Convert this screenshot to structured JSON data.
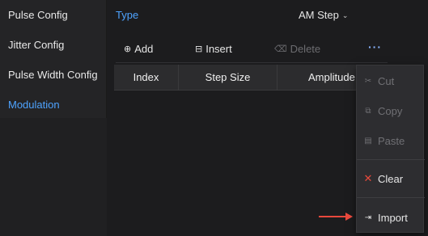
{
  "sidebar": {
    "items": [
      {
        "label": "Pulse Config"
      },
      {
        "label": "Jitter Config"
      },
      {
        "label": "Pulse Width Config"
      },
      {
        "label": "Modulation"
      }
    ]
  },
  "main": {
    "type_label": "Type",
    "type_value": "AM Step"
  },
  "toolbar": {
    "add_label": "Add",
    "insert_label": "Insert",
    "delete_label": "Delete"
  },
  "table": {
    "columns": [
      "Index",
      "Step Size",
      "Amplitude"
    ]
  },
  "menu": {
    "items": [
      {
        "label": "Cut",
        "icon": "scissors-icon",
        "enabled": false
      },
      {
        "label": "Copy",
        "icon": "copy-icon",
        "enabled": false
      },
      {
        "label": "Paste",
        "icon": "paste-icon",
        "enabled": false
      },
      {
        "label": "Clear",
        "icon": "close-icon",
        "enabled": true
      },
      {
        "label": "Import",
        "icon": "import-icon",
        "enabled": true
      }
    ]
  },
  "colors": {
    "accent": "#4ea3ff",
    "clear_icon": "#e84a3c",
    "annotation_arrow": "#e8483c"
  }
}
